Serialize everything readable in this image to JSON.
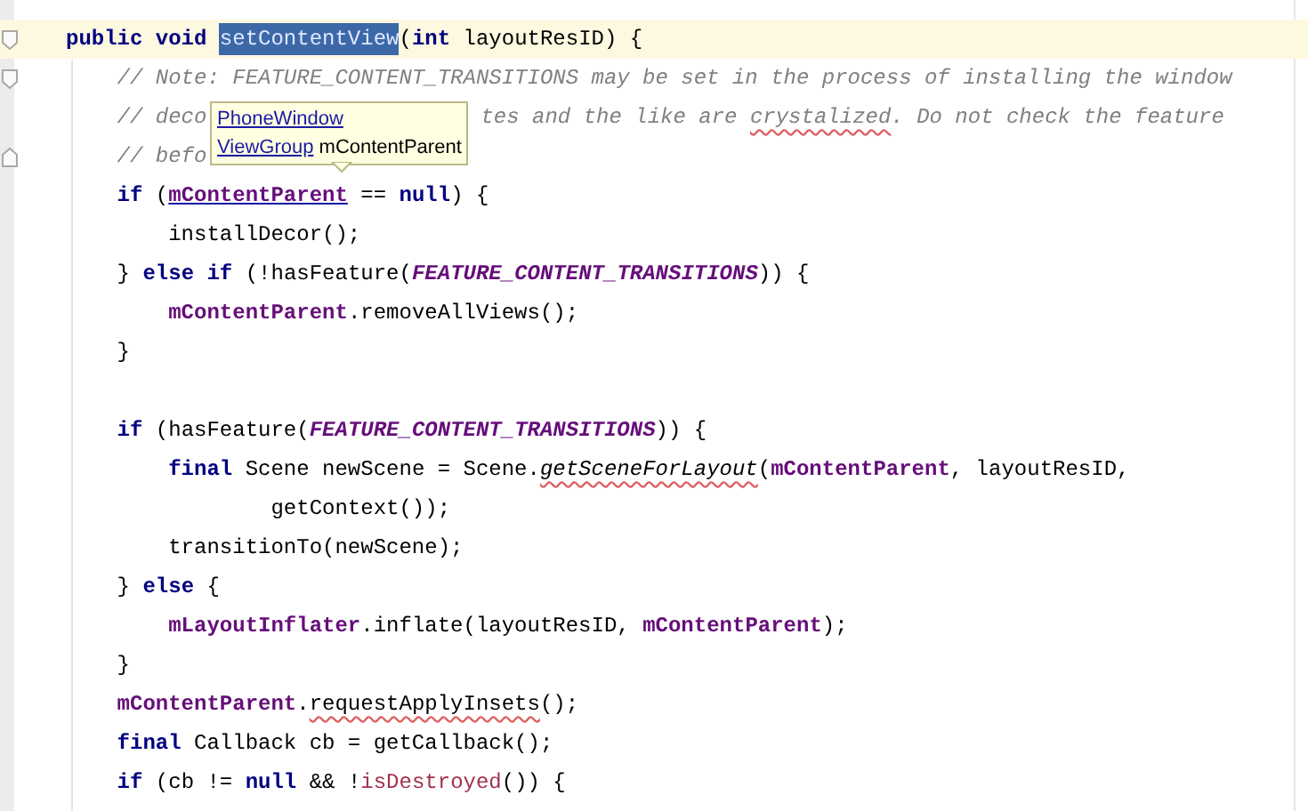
{
  "editor": {
    "lines": [
      {
        "fold_open": true,
        "fold_close": false,
        "current": true,
        "tokens": [
          {
            "text": "public void ",
            "kind": "keyword",
            "typo": false
          },
          {
            "text": "setContentView",
            "kind": "selected",
            "typo": false
          },
          {
            "text": "(",
            "kind": "plain",
            "typo": false
          },
          {
            "text": "int",
            "kind": "keyword",
            "typo": false
          },
          {
            "text": " layoutResID) {",
            "kind": "plain",
            "typo": false
          }
        ]
      },
      {
        "fold_open": true,
        "fold_close": false,
        "current": false,
        "tokens": [
          {
            "text": "    // Note: FEATURE_CONTENT_TRANSITIONS may be set in the process of installing the window",
            "kind": "comment",
            "typo": false
          }
        ]
      },
      {
        "fold_open": false,
        "fold_close": false,
        "current": false,
        "tokens": [
          {
            "text": "    // deco",
            "kind": "comment",
            "typo": false
          },
          {
            "kind": "gap"
          },
          {
            "text": "tes and the like are ",
            "kind": "comment",
            "typo": false
          },
          {
            "text": "crystalized",
            "kind": "comment",
            "typo": true
          },
          {
            "text": ". Do not check the feature",
            "kind": "comment",
            "typo": false
          }
        ]
      },
      {
        "fold_open": false,
        "fold_close": true,
        "current": false,
        "tokens": [
          {
            "text": "    // befo",
            "kind": "comment",
            "typo": false
          }
        ]
      },
      {
        "fold_open": false,
        "fold_close": false,
        "current": false,
        "tokens": [
          {
            "text": "    if",
            "kind": "keyword",
            "typo": false
          },
          {
            "text": " (",
            "kind": "plain",
            "typo": false
          },
          {
            "text": "mContentParent",
            "kind": "link",
            "typo": false
          },
          {
            "text": " == ",
            "kind": "plain",
            "typo": false
          },
          {
            "text": "null",
            "kind": "keyword",
            "typo": false
          },
          {
            "text": ") {",
            "kind": "plain",
            "typo": false
          }
        ]
      },
      {
        "fold_open": false,
        "fold_close": false,
        "current": false,
        "tokens": [
          {
            "text": "        installDecor();",
            "kind": "plain",
            "typo": false
          }
        ]
      },
      {
        "fold_open": false,
        "fold_close": false,
        "current": false,
        "tokens": [
          {
            "text": "    } ",
            "kind": "plain",
            "typo": false
          },
          {
            "text": "else if",
            "kind": "keyword",
            "typo": false
          },
          {
            "text": " (!hasFeature(",
            "kind": "plain",
            "typo": false
          },
          {
            "text": "FEATURE_CONTENT_TRANSITIONS",
            "kind": "constant",
            "typo": false
          },
          {
            "text": ")) {",
            "kind": "plain",
            "typo": false
          }
        ]
      },
      {
        "fold_open": false,
        "fold_close": false,
        "current": false,
        "tokens": [
          {
            "text": "        mContentParent",
            "kind": "field",
            "typo": false
          },
          {
            "text": ".removeAllViews();",
            "kind": "plain",
            "typo": false
          }
        ]
      },
      {
        "fold_open": false,
        "fold_close": false,
        "current": false,
        "tokens": [
          {
            "text": "    }",
            "kind": "plain",
            "typo": false
          }
        ]
      },
      {
        "fold_open": false,
        "fold_close": false,
        "current": false
      },
      {
        "fold_open": false,
        "fold_close": false,
        "current": false,
        "tokens": [
          {
            "text": "    if",
            "kind": "keyword",
            "typo": false
          },
          {
            "text": " (hasFeature(",
            "kind": "plain",
            "typo": false
          },
          {
            "text": "FEATURE_CONTENT_TRANSITIONS",
            "kind": "constant",
            "typo": false
          },
          {
            "text": ")) {",
            "kind": "plain",
            "typo": false
          }
        ]
      },
      {
        "fold_open": false,
        "fold_close": false,
        "current": false,
        "tokens": [
          {
            "text": "        final",
            "kind": "keyword",
            "typo": false
          },
          {
            "text": " Scene newScene = Scene.",
            "kind": "plain",
            "typo": false
          },
          {
            "text": "getSceneForLayout",
            "kind": "static",
            "typo": true
          },
          {
            "text": "(",
            "kind": "plain",
            "typo": false
          },
          {
            "text": "mContentParent",
            "kind": "field",
            "typo": false
          },
          {
            "text": ", layoutResID,",
            "kind": "plain",
            "typo": false
          }
        ]
      },
      {
        "fold_open": false,
        "fold_close": false,
        "current": false,
        "tokens": [
          {
            "text": "                getContext());",
            "kind": "plain",
            "typo": false
          }
        ]
      },
      {
        "fold_open": false,
        "fold_close": false,
        "current": false,
        "tokens": [
          {
            "text": "        transitionTo(newScene);",
            "kind": "plain",
            "typo": false
          }
        ]
      },
      {
        "fold_open": false,
        "fold_close": false,
        "current": false,
        "tokens": [
          {
            "text": "    } ",
            "kind": "plain",
            "typo": false
          },
          {
            "text": "else",
            "kind": "keyword",
            "typo": false
          },
          {
            "text": " {",
            "kind": "plain",
            "typo": false
          }
        ]
      },
      {
        "fold_open": false,
        "fold_close": false,
        "current": false,
        "tokens": [
          {
            "text": "        mLayoutInflater",
            "kind": "field",
            "typo": false
          },
          {
            "text": ".inflate(layoutResID, ",
            "kind": "plain",
            "typo": false
          },
          {
            "text": "mContentParent",
            "kind": "field",
            "typo": false
          },
          {
            "text": ");",
            "kind": "plain",
            "typo": false
          }
        ]
      },
      {
        "fold_open": false,
        "fold_close": false,
        "current": false,
        "tokens": [
          {
            "text": "    }",
            "kind": "plain",
            "typo": false
          }
        ]
      },
      {
        "fold_open": false,
        "fold_close": false,
        "current": false,
        "tokens": [
          {
            "text": "    mContentParent",
            "kind": "field",
            "typo": false
          },
          {
            "text": ".",
            "kind": "plain",
            "typo": false
          },
          {
            "text": "requestApplyInsets",
            "kind": "plain",
            "typo": true
          },
          {
            "text": "();",
            "kind": "plain",
            "typo": false
          }
        ]
      },
      {
        "fold_open": false,
        "fold_close": false,
        "current": false,
        "tokens": [
          {
            "text": "    final",
            "kind": "keyword",
            "typo": false
          },
          {
            "text": " Callback cb = getCallback();",
            "kind": "plain",
            "typo": false
          }
        ]
      },
      {
        "fold_open": false,
        "fold_close": false,
        "current": false,
        "tokens": [
          {
            "text": "    if",
            "kind": "keyword",
            "typo": false
          },
          {
            "text": " (cb != ",
            "kind": "plain",
            "typo": false
          },
          {
            "text": "null",
            "kind": "keyword",
            "typo": false
          },
          {
            "text": " && !",
            "kind": "plain",
            "typo": false
          },
          {
            "text": "isDestroyed",
            "kind": "inherited",
            "typo": false
          },
          {
            "text": "()) {",
            "kind": "plain",
            "typo": false
          }
        ]
      }
    ]
  },
  "tooltip": {
    "lines": [
      [
        {
          "text": "PhoneWindow",
          "kind": "link"
        }
      ],
      [
        {
          "text": "ViewGroup",
          "kind": "link"
        },
        {
          "text": " mContentParent",
          "kind": "plain"
        }
      ]
    ]
  }
}
